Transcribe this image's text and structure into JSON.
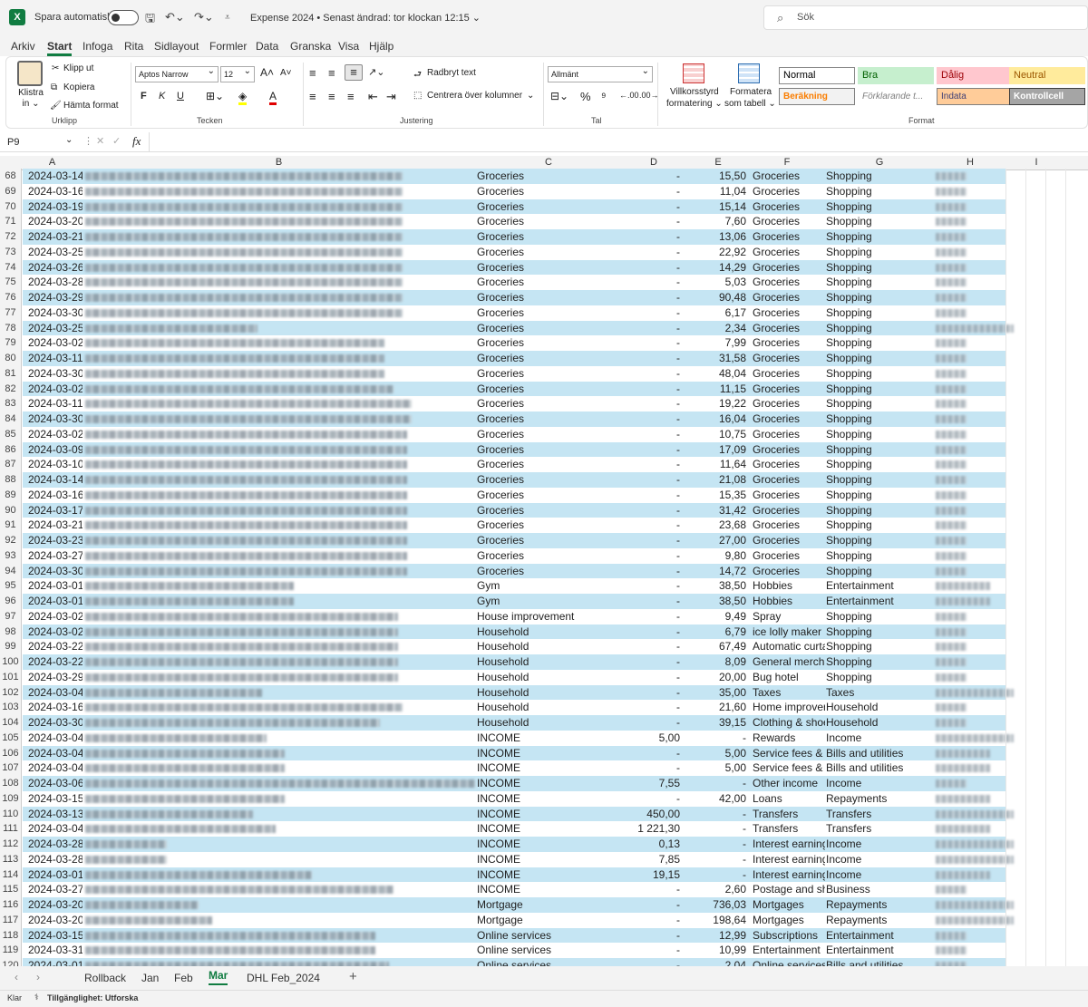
{
  "titlebar": {
    "logo": "X",
    "autosave_label": "Spara automatiskt",
    "doc_title": "Expense 2024 • Senast ändrad: tor klockan 12:15 ⌄",
    "search_placeholder": "Sök"
  },
  "menu": [
    "Arkiv",
    "Start",
    "Infoga",
    "Rita",
    "Sidlayout",
    "Formler",
    "Data",
    "Granska",
    "Visa",
    "Hjälp"
  ],
  "menu_active": "Start",
  "ribbon": {
    "paste": "Klistra in ⌄",
    "cut": "Klipp ut",
    "copy": "Kopiera",
    "format_painter": "Hämta format",
    "clipboard_label": "Urklipp",
    "font_name": "Aptos Narrow",
    "font_size": "12",
    "bold": "F",
    "italic": "K",
    "underline": "U",
    "font_label": "Tecken",
    "wrap": "Radbryt text",
    "merge": "Centrera över kolumner",
    "alignment_label": "Justering",
    "number_format": "Allmänt",
    "number_label": "Tal",
    "cond_format_1": "Villkorsstyrd",
    "cond_format_2": "formatering ⌄",
    "table_format_1": "Formatera",
    "table_format_2": "som tabell ⌄",
    "styles": [
      {
        "label": "Normal",
        "bg": "#ffffff",
        "color": "#000000",
        "border": "#888888"
      },
      {
        "label": "Bra",
        "bg": "#c6efce",
        "color": "#006100",
        "border": "#c6efce"
      },
      {
        "label": "Dålig",
        "bg": "#ffc7ce",
        "color": "#9c0006",
        "border": "#ffc7ce"
      },
      {
        "label": "Neutral",
        "bg": "#ffeb9c",
        "color": "#9c5700",
        "border": "#ffeb9c"
      },
      {
        "label": "Beräkning",
        "bg": "#f2f2f2",
        "color": "#fa7d00",
        "border": "#7f7f7f"
      },
      {
        "label": "Förklarande t...",
        "bg": "#ffffff",
        "color": "#7f7f7f",
        "border": "#ffffff"
      },
      {
        "label": "Indata",
        "bg": "#ffcc99",
        "color": "#3f3f76",
        "border": "#7f7f7f"
      },
      {
        "label": "Kontrollcell",
        "bg": "#a5a5a5",
        "color": "#ffffff",
        "border": "#3f3f3f"
      }
    ],
    "format_label": "Format"
  },
  "formula": {
    "namebox": "P9",
    "fx": "fx"
  },
  "columns": [
    "A",
    "B",
    "C",
    "D",
    "E",
    "F",
    "G",
    "H",
    "I"
  ],
  "band_color": "#c5e5f3",
  "rows": [
    {
      "n": "68",
      "date": "2024-03-14",
      "cat": "Groceries",
      "d": "-",
      "e": "15,50",
      "f": "Groceries",
      "g": "Shopping",
      "bw": 350
    },
    {
      "n": "69",
      "date": "2024-03-16",
      "cat": "Groceries",
      "d": "-",
      "e": "11,04",
      "f": "Groceries",
      "g": "Shopping",
      "bw": 350
    },
    {
      "n": "70",
      "date": "2024-03-19",
      "cat": "Groceries",
      "d": "-",
      "e": "15,14",
      "f": "Groceries",
      "g": "Shopping",
      "bw": 350
    },
    {
      "n": "71",
      "date": "2024-03-20",
      "cat": "Groceries",
      "d": "-",
      "e": "7,60",
      "f": "Groceries",
      "g": "Shopping",
      "bw": 350
    },
    {
      "n": "72",
      "date": "2024-03-21",
      "cat": "Groceries",
      "d": "-",
      "e": "13,06",
      "f": "Groceries",
      "g": "Shopping",
      "bw": 350
    },
    {
      "n": "73",
      "date": "2024-03-25",
      "cat": "Groceries",
      "d": "-",
      "e": "22,92",
      "f": "Groceries",
      "g": "Shopping",
      "bw": 350
    },
    {
      "n": "74",
      "date": "2024-03-26",
      "cat": "Groceries",
      "d": "-",
      "e": "14,29",
      "f": "Groceries",
      "g": "Shopping",
      "bw": 350
    },
    {
      "n": "75",
      "date": "2024-03-28",
      "cat": "Groceries",
      "d": "-",
      "e": "5,03",
      "f": "Groceries",
      "g": "Shopping",
      "bw": 350
    },
    {
      "n": "76",
      "date": "2024-03-29",
      "cat": "Groceries",
      "d": "-",
      "e": "90,48",
      "f": "Groceries",
      "g": "Shopping",
      "bw": 350
    },
    {
      "n": "77",
      "date": "2024-03-30",
      "cat": "Groceries",
      "d": "-",
      "e": "6,17",
      "f": "Groceries",
      "g": "Shopping",
      "bw": 350
    },
    {
      "n": "78",
      "date": "2024-03-25",
      "cat": "Groceries",
      "d": "-",
      "e": "2,34",
      "f": "Groceries",
      "g": "Shopping",
      "bw": 190
    },
    {
      "n": "79",
      "date": "2024-03-02",
      "cat": "Groceries",
      "d": "-",
      "e": "7,99",
      "f": "Groceries",
      "g": "Shopping",
      "bw": 330
    },
    {
      "n": "80",
      "date": "2024-03-11",
      "cat": "Groceries",
      "d": "-",
      "e": "31,58",
      "f": "Groceries",
      "g": "Shopping",
      "bw": 330
    },
    {
      "n": "81",
      "date": "2024-03-30",
      "cat": "Groceries",
      "d": "-",
      "e": "48,04",
      "f": "Groceries",
      "g": "Shopping",
      "bw": 330
    },
    {
      "n": "82",
      "date": "2024-03-02",
      "cat": "Groceries",
      "d": "-",
      "e": "11,15",
      "f": "Groceries",
      "g": "Shopping",
      "bw": 340
    },
    {
      "n": "83",
      "date": "2024-03-11",
      "cat": "Groceries",
      "d": "-",
      "e": "19,22",
      "f": "Groceries",
      "g": "Shopping",
      "bw": 360
    },
    {
      "n": "84",
      "date": "2024-03-30",
      "cat": "Groceries",
      "d": "-",
      "e": "16,04",
      "f": "Groceries",
      "g": "Shopping",
      "bw": 360
    },
    {
      "n": "85",
      "date": "2024-03-02",
      "cat": "Groceries",
      "d": "-",
      "e": "10,75",
      "f": "Groceries",
      "g": "Shopping",
      "bw": 355
    },
    {
      "n": "86",
      "date": "2024-03-09",
      "cat": "Groceries",
      "d": "-",
      "e": "17,09",
      "f": "Groceries",
      "g": "Shopping",
      "bw": 355
    },
    {
      "n": "87",
      "date": "2024-03-10",
      "cat": "Groceries",
      "d": "-",
      "e": "11,64",
      "f": "Groceries",
      "g": "Shopping",
      "bw": 355
    },
    {
      "n": "88",
      "date": "2024-03-14",
      "cat": "Groceries",
      "d": "-",
      "e": "21,08",
      "f": "Groceries",
      "g": "Shopping",
      "bw": 355
    },
    {
      "n": "89",
      "date": "2024-03-16",
      "cat": "Groceries",
      "d": "-",
      "e": "15,35",
      "f": "Groceries",
      "g": "Shopping",
      "bw": 355
    },
    {
      "n": "90",
      "date": "2024-03-17",
      "cat": "Groceries",
      "d": "-",
      "e": "31,42",
      "f": "Groceries",
      "g": "Shopping",
      "bw": 355
    },
    {
      "n": "91",
      "date": "2024-03-21",
      "cat": "Groceries",
      "d": "-",
      "e": "23,68",
      "f": "Groceries",
      "g": "Shopping",
      "bw": 355
    },
    {
      "n": "92",
      "date": "2024-03-23",
      "cat": "Groceries",
      "d": "-",
      "e": "27,00",
      "f": "Groceries",
      "g": "Shopping",
      "bw": 355
    },
    {
      "n": "93",
      "date": "2024-03-27",
      "cat": "Groceries",
      "d": "-",
      "e": "9,80",
      "f": "Groceries",
      "g": "Shopping",
      "bw": 355
    },
    {
      "n": "94",
      "date": "2024-03-30",
      "cat": "Groceries",
      "d": "-",
      "e": "14,72",
      "f": "Groceries",
      "g": "Shopping",
      "bw": 355
    },
    {
      "n": "95",
      "date": "2024-03-01",
      "cat": "Gym",
      "d": "-",
      "e": "38,50",
      "f": "Hobbies",
      "g": "Entertainment",
      "bw": 230
    },
    {
      "n": "96",
      "date": "2024-03-01",
      "cat": "Gym",
      "d": "-",
      "e": "38,50",
      "f": "Hobbies",
      "g": "Entertainment",
      "bw": 230
    },
    {
      "n": "97",
      "date": "2024-03-02",
      "cat": "House improvement",
      "d": "-",
      "e": "9,49",
      "f": "Spray",
      "g": "Shopping",
      "bw": 345
    },
    {
      "n": "98",
      "date": "2024-03-02",
      "cat": "Household",
      "d": "-",
      "e": "6,79",
      "f": "ice lolly maker",
      "g": "Shopping",
      "bw": 345
    },
    {
      "n": "99",
      "date": "2024-03-22",
      "cat": "Household",
      "d": "-",
      "e": "67,49",
      "f": "Automatic curta",
      "g": "Shopping",
      "bw": 345
    },
    {
      "n": "100",
      "date": "2024-03-22",
      "cat": "Household",
      "d": "-",
      "e": "8,09",
      "f": "General mercha",
      "g": "Shopping",
      "bw": 345
    },
    {
      "n": "101",
      "date": "2024-03-29",
      "cat": "Household",
      "d": "-",
      "e": "20,00",
      "f": "Bug hotel",
      "g": "Shopping",
      "bw": 345
    },
    {
      "n": "102",
      "date": "2024-03-04",
      "cat": "Household",
      "d": "-",
      "e": "35,00",
      "f": "Taxes",
      "g": "Taxes",
      "bw": 195
    },
    {
      "n": "103",
      "date": "2024-03-16",
      "cat": "Household",
      "d": "-",
      "e": "21,60",
      "f": "Home improver",
      "g": "Household",
      "bw": 350
    },
    {
      "n": "104",
      "date": "2024-03-30",
      "cat": "Household",
      "d": "-",
      "e": "39,15",
      "f": "Clothing & shoe",
      "g": "Household",
      "bw": 325
    },
    {
      "n": "105",
      "date": "2024-03-04",
      "cat": "INCOME",
      "d": "5,00",
      "e": "-",
      "f": "Rewards",
      "g": "Income",
      "bw": 200
    },
    {
      "n": "106",
      "date": "2024-03-04",
      "cat": "INCOME",
      "d": "-",
      "e": "5,00",
      "f": "Service fees & b",
      "g": "Bills and utilities",
      "bw": 220
    },
    {
      "n": "107",
      "date": "2024-03-04",
      "cat": "INCOME",
      "d": "-",
      "e": "5,00",
      "f": "Service fees & b",
      "g": "Bills and utilities",
      "bw": 220
    },
    {
      "n": "108",
      "date": "2024-03-06",
      "cat": "INCOME",
      "d": "7,55",
      "e": "-",
      "f": "Other income",
      "g": "Income",
      "bw": 430
    },
    {
      "n": "109",
      "date": "2024-03-15",
      "cat": "INCOME",
      "d": "-",
      "e": "42,00",
      "f": "Loans",
      "g": "Repayments",
      "bw": 220
    },
    {
      "n": "110",
      "date": "2024-03-13",
      "cat": "INCOME",
      "d": "450,00",
      "e": "-",
      "f": "Transfers",
      "g": "Transfers",
      "bw": 185
    },
    {
      "n": "111",
      "date": "2024-03-04",
      "cat": "INCOME",
      "d": "1 221,30",
      "e": "-",
      "f": "Transfers",
      "g": "Transfers",
      "bw": 210
    },
    {
      "n": "112",
      "date": "2024-03-28",
      "cat": "INCOME",
      "d": "0,13",
      "e": "-",
      "f": "Interest earning",
      "g": "Income",
      "bw": 90
    },
    {
      "n": "113",
      "date": "2024-03-28",
      "cat": "INCOME",
      "d": "7,85",
      "e": "-",
      "f": "Interest earning",
      "g": "Income",
      "bw": 90
    },
    {
      "n": "114",
      "date": "2024-03-01",
      "cat": "INCOME",
      "d": "19,15",
      "e": "-",
      "f": "Interest earning",
      "g": "Income",
      "bw": 250
    },
    {
      "n": "115",
      "date": "2024-03-27",
      "cat": "INCOME",
      "d": "-",
      "e": "2,60",
      "f": "Postage and shi",
      "g": "Business",
      "bw": 340
    },
    {
      "n": "116",
      "date": "2024-03-20",
      "cat": "Mortgage",
      "d": "-",
      "e": "736,03",
      "f": "Mortgages",
      "g": "Repayments",
      "bw": 125
    },
    {
      "n": "117",
      "date": "2024-03-20",
      "cat": "Mortgage",
      "d": "-",
      "e": "198,64",
      "f": "Mortgages",
      "g": "Repayments",
      "bw": 140
    },
    {
      "n": "118",
      "date": "2024-03-15",
      "cat": "Online services",
      "d": "-",
      "e": "12,99",
      "f": "Subscriptions",
      "g": "Entertainment",
      "bw": 320
    },
    {
      "n": "119",
      "date": "2024-03-31",
      "cat": "Online services",
      "d": "-",
      "e": "10,99",
      "f": "Entertainment",
      "g": "Entertainment",
      "bw": 320
    },
    {
      "n": "120",
      "date": "2024-03-01",
      "cat": "Online services",
      "d": "-",
      "e": "2,04",
      "f": "Online services",
      "g": "Bills and utilities",
      "bw": 335
    }
  ],
  "sheets": [
    "Rollback",
    "Jan",
    "Feb",
    "Mar",
    "DHL Feb_2024"
  ],
  "active_sheet": "Mar",
  "status": {
    "ready": "Klar",
    "accessibility": "Tillgänglighet: Utforska"
  }
}
